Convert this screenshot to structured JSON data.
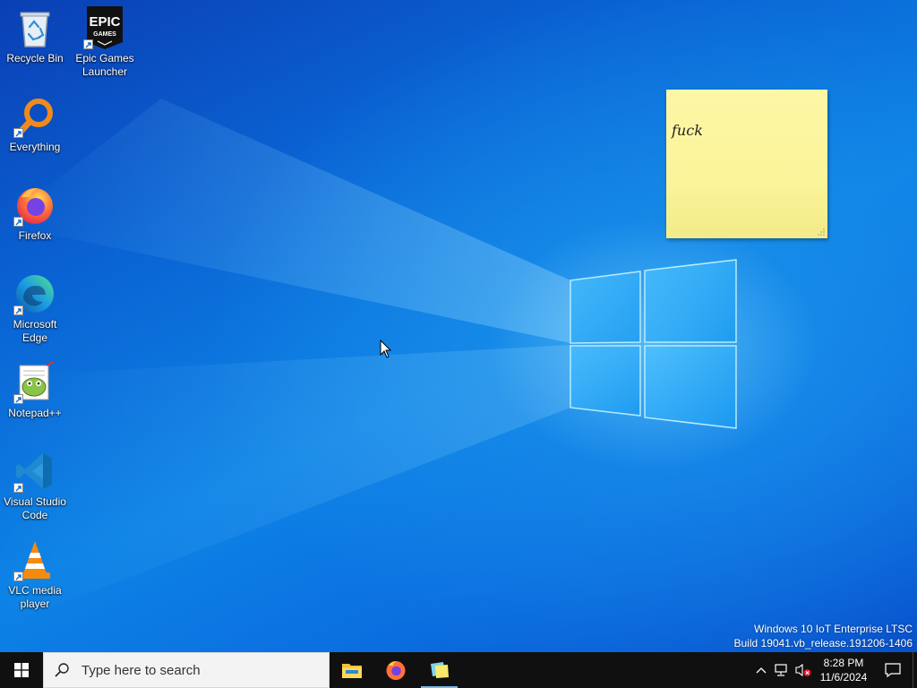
{
  "desktop_icons": [
    {
      "label": "Recycle Bin",
      "icon": "recycle-bin-icon"
    },
    {
      "label": "Epic Games Launcher",
      "icon": "epic-games-icon",
      "logo_text": "EPIC GAMES"
    },
    {
      "label": "Everything",
      "icon": "everything-search-icon"
    },
    {
      "label": "Firefox",
      "icon": "firefox-icon"
    },
    {
      "label": "Microsoft Edge",
      "icon": "edge-icon"
    },
    {
      "label": "Notepad++",
      "icon": "notepad-plus-plus-icon"
    },
    {
      "label": "Visual Studio Code",
      "icon": "vscode-icon"
    },
    {
      "label": "VLC media player",
      "icon": "vlc-icon"
    }
  ],
  "sticky_note": {
    "text": "fuck"
  },
  "watermark": {
    "line1": "Windows 10 IoT Enterprise LTSC",
    "line2": "Build 19041.vb_release.191206-1406"
  },
  "taskbar": {
    "search_placeholder": "Type here to search",
    "pinned": [
      {
        "name": "File Explorer",
        "icon": "file-explorer-icon"
      },
      {
        "name": "Firefox",
        "icon": "firefox-icon"
      },
      {
        "name": "Sticky Notes",
        "icon": "sticky-notes-icon",
        "active": true
      }
    ],
    "clock": {
      "time": "8:28 PM",
      "date": "11/6/2024"
    }
  },
  "colors": {
    "taskbar_bg": "#101010",
    "search_bg": "#f3f3f3",
    "note_bg": "#fdf7a6",
    "active_indicator": "#76b9ed"
  }
}
